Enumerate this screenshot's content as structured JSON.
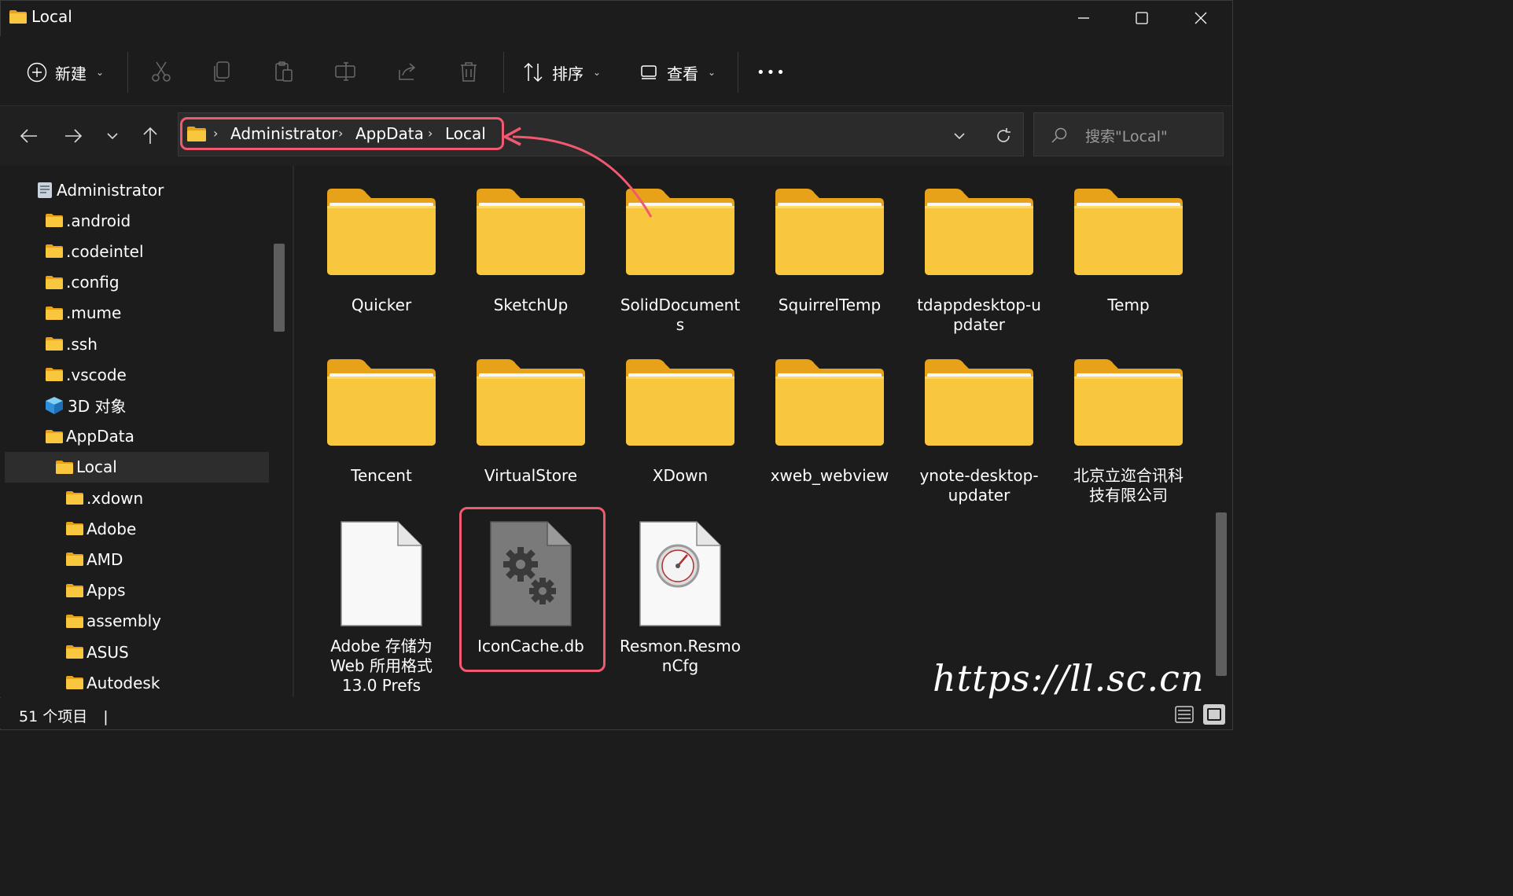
{
  "window": {
    "title": "Local"
  },
  "toolbar": {
    "new_label": "新建",
    "sort_label": "排序",
    "view_label": "查看",
    "more_label": "•••"
  },
  "address": {
    "segments": [
      "Administrator",
      "AppData",
      "Local"
    ]
  },
  "search": {
    "placeholder": "搜索\"Local\""
  },
  "sidebar": {
    "items": [
      {
        "label": "Administrator",
        "icon": "user-folder-icon"
      },
      {
        "label": ".android",
        "icon": "folder-icon"
      },
      {
        "label": ".codeintel",
        "icon": "folder-icon"
      },
      {
        "label": ".config",
        "icon": "folder-icon"
      },
      {
        "label": ".mume",
        "icon": "folder-icon"
      },
      {
        "label": ".ssh",
        "icon": "folder-icon"
      },
      {
        "label": ".vscode",
        "icon": "folder-icon"
      },
      {
        "label": "3D 对象",
        "icon": "3d-objects-icon"
      },
      {
        "label": "AppData",
        "icon": "folder-icon"
      },
      {
        "label": "Local",
        "icon": "folder-icon"
      },
      {
        "label": ".xdown",
        "icon": "folder-icon"
      },
      {
        "label": "Adobe",
        "icon": "folder-icon"
      },
      {
        "label": "AMD",
        "icon": "folder-icon"
      },
      {
        "label": "Apps",
        "icon": "folder-icon"
      },
      {
        "label": "assembly",
        "icon": "folder-icon"
      },
      {
        "label": "ASUS",
        "icon": "folder-icon"
      },
      {
        "label": "Autodesk",
        "icon": "folder-icon"
      }
    ]
  },
  "content": {
    "items": [
      {
        "label": "Quicker",
        "type": "folder"
      },
      {
        "label": "SketchUp",
        "type": "folder"
      },
      {
        "label": "SolidDocument\ns",
        "type": "folder"
      },
      {
        "label": "SquirrelTemp",
        "type": "folder"
      },
      {
        "label": "tdappdesktop-u\npdater",
        "type": "folder"
      },
      {
        "label": "Temp",
        "type": "folder"
      },
      {
        "label": "Tencent",
        "type": "folder"
      },
      {
        "label": "VirtualStore",
        "type": "folder"
      },
      {
        "label": "XDown",
        "type": "folder"
      },
      {
        "label": "xweb_webview",
        "type": "folder"
      },
      {
        "label": "ynote-desktop-\nupdater",
        "type": "folder"
      },
      {
        "label": "北京立迩合讯科\n技有限公司",
        "type": "folder"
      },
      {
        "label": "Adobe 存储为\nWeb 所用格式\n13.0 Prefs",
        "type": "blank-file"
      },
      {
        "label": "IconCache.db",
        "type": "system-file"
      },
      {
        "label": "Resmon.Resmo\nnCfg",
        "type": "resmon-file"
      }
    ]
  },
  "status": {
    "count_text": "51 个项目",
    "separator": "|"
  },
  "watermark": {
    "text": "https://ll.sc.cn"
  },
  "colors": {
    "highlight": "#f0596f",
    "folder": "#f9c73d",
    "folder_back": "#e8a219"
  }
}
